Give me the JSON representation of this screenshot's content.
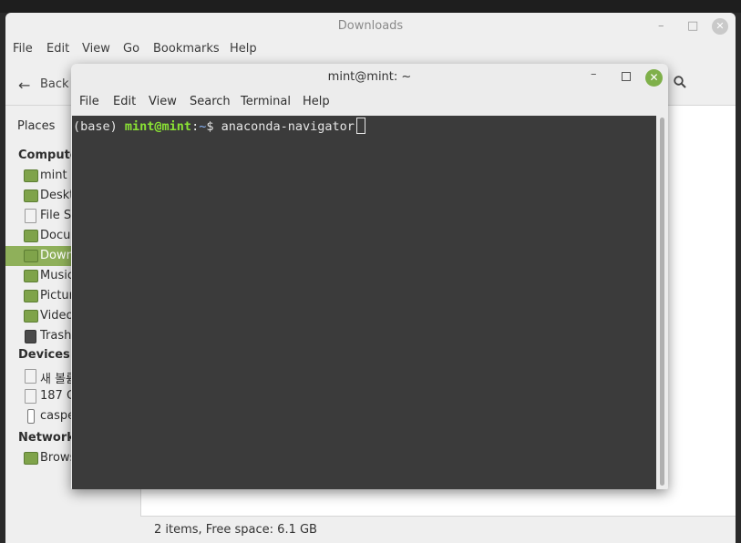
{
  "file_manager": {
    "title": "Downloads",
    "window_controls": {
      "minimize": "–",
      "maximize": "□",
      "close": "✕"
    },
    "menu": [
      "File",
      "Edit",
      "View",
      "Go",
      "Bookmarks",
      "Help"
    ],
    "toolbar": {
      "back_label": "Back"
    },
    "places_label": "Places",
    "sidebar": {
      "computer_heading": "Compute",
      "computer_items": [
        {
          "label": "mint",
          "icon": "home-folder-icon",
          "selected": false
        },
        {
          "label": "Deskt",
          "icon": "desktop-folder-icon",
          "selected": false
        },
        {
          "label": "File Sy",
          "icon": "drive-icon",
          "selected": false
        },
        {
          "label": "Docu",
          "icon": "documents-folder-icon",
          "selected": false
        },
        {
          "label": "Down",
          "icon": "downloads-folder-icon",
          "selected": true
        },
        {
          "label": "Music",
          "icon": "music-folder-icon",
          "selected": false
        },
        {
          "label": "Pictur",
          "icon": "pictures-folder-icon",
          "selected": false
        },
        {
          "label": "Video",
          "icon": "videos-folder-icon",
          "selected": false
        },
        {
          "label": "Trash",
          "icon": "trash-icon",
          "selected": false
        }
      ],
      "devices_heading": "Devices",
      "device_items": [
        {
          "label": "새 볼륨",
          "icon": "drive-icon"
        },
        {
          "label": "187 C",
          "icon": "drive-icon"
        },
        {
          "label": "caspe",
          "icon": "usb-icon"
        }
      ],
      "network_heading": "Network",
      "network_items": [
        {
          "label": "Brows",
          "icon": "network-folder-icon"
        }
      ]
    },
    "status": "2 items, Free space: 6.1 GB",
    "accent_color": "#8fb05a"
  },
  "terminal": {
    "title": "mint@mint: ~",
    "window_controls": {
      "minimize": "–",
      "maximize": "□",
      "close": "✕"
    },
    "menu": [
      "File",
      "Edit",
      "View",
      "Search",
      "Terminal",
      "Help"
    ],
    "prompt": {
      "env": "(base) ",
      "user_host": "mint@mint",
      "separator": ":",
      "path": "~",
      "symbol": "$ ",
      "command": "anaconda-navigator"
    },
    "background_color": "#3b3b3b",
    "user_color": "#8ae234"
  }
}
